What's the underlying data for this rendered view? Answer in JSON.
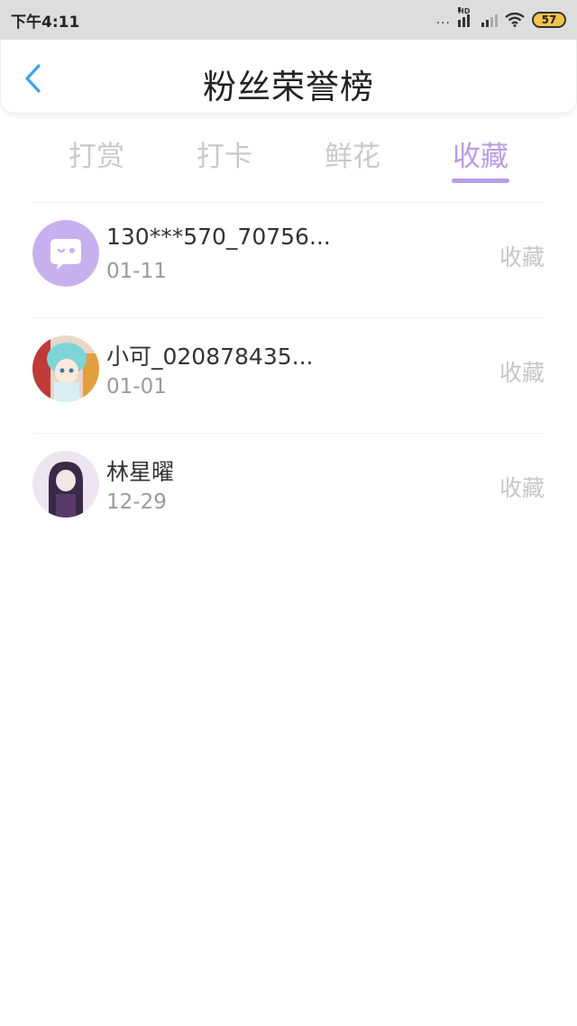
{
  "status": {
    "time": "下午4:11",
    "dots": "...",
    "hd": "HD",
    "battery": "57"
  },
  "header": {
    "title": "粉丝荣誉榜"
  },
  "tabs": [
    {
      "label": "打赏"
    },
    {
      "label": "打卡"
    },
    {
      "label": "鲜花"
    },
    {
      "label": "收藏"
    }
  ],
  "list": [
    {
      "name": "130***570_70756...",
      "date": "01-11",
      "action": "收藏"
    },
    {
      "name": "小可_020878435...",
      "date": "01-01",
      "action": "收藏"
    },
    {
      "name": "林星曜",
      "date": "12-29",
      "action": "收藏"
    }
  ],
  "colors": {
    "accent": "#b99be6",
    "back_arrow": "#3aa3f0"
  }
}
